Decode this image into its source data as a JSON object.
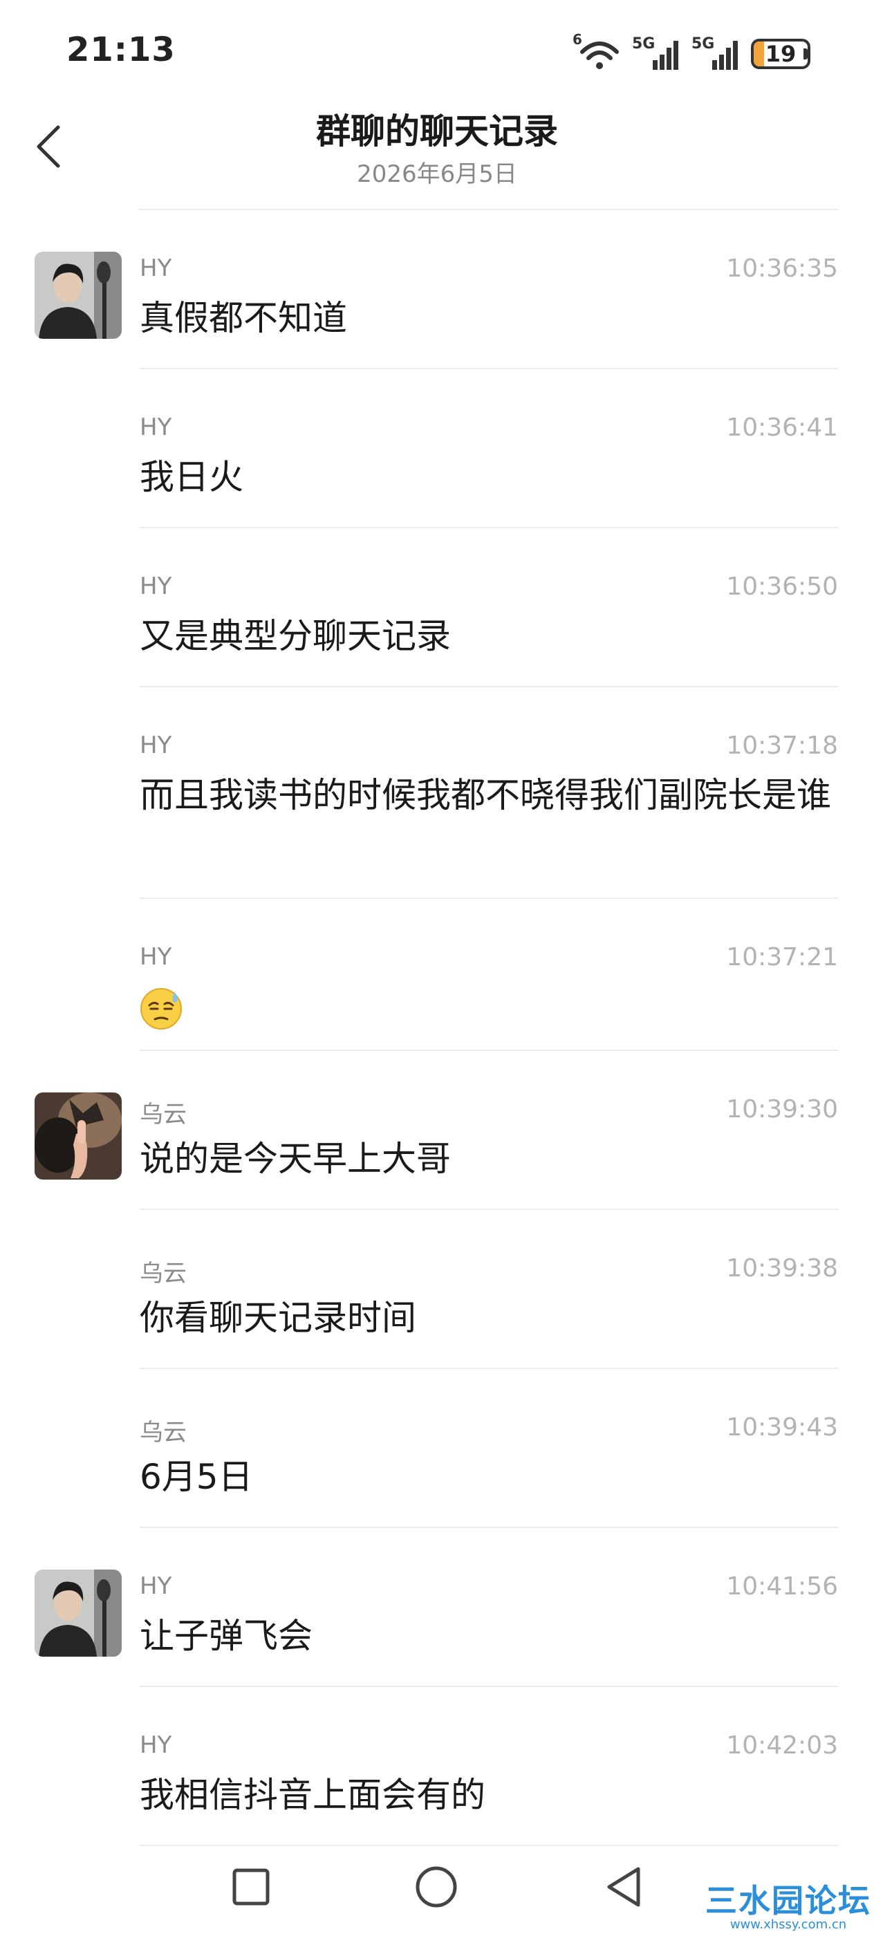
{
  "status_bar": {
    "time": "21:13",
    "battery": "19",
    "battery_level": 0.19,
    "icons": [
      "wifi-icon",
      "signal-5g-sim1-icon",
      "signal-5g-sim2-icon",
      "battery-icon"
    ],
    "wifi_badge": "6",
    "sim1_label": "5G",
    "sim2_label": "5G"
  },
  "header": {
    "title": "群聊的聊天记录",
    "subtitle": "2026年6月5日",
    "back_icon": "chevron-left-icon"
  },
  "messages": [
    {
      "sender": "HY",
      "time": "10:36:35",
      "text": "真假都不知道",
      "avatar": "hy"
    },
    {
      "sender": "HY",
      "time": "10:36:41",
      "text": "我日火"
    },
    {
      "sender": "HY",
      "time": "10:36:50",
      "text": "又是典型分聊天记录"
    },
    {
      "sender": "HY",
      "time": "10:37:18",
      "text": "而且我读书的时候我都不晓得我们副院长是谁"
    },
    {
      "sender": "HY",
      "time": "10:37:21",
      "text": "",
      "emoji": "sweat-face-emoji"
    },
    {
      "sender": "乌云",
      "time": "10:39:30",
      "text": "说的是今天早上大哥",
      "avatar": "wuyun"
    },
    {
      "sender": "乌云",
      "time": "10:39:38",
      "text": "你看聊天记录时间"
    },
    {
      "sender": "乌云",
      "time": "10:39:43",
      "text": "6月5日"
    },
    {
      "sender": "HY",
      "time": "10:41:56",
      "text": "让子弹飞会",
      "avatar": "hy"
    },
    {
      "sender": "HY",
      "time": "10:42:03",
      "text": "我相信抖音上面会有的"
    }
  ],
  "nav_bar": {
    "icons": [
      "recents-square-icon",
      "home-circle-icon",
      "back-triangle-icon"
    ]
  },
  "watermark": {
    "brand": "三水园论坛",
    "url": "www.xhssy.com.cn"
  },
  "colors": {
    "text": "#1a1a1a",
    "meta": "#8a8a8a",
    "time": "#b3b3b3",
    "divider": "#ececec",
    "battery": "#f2a33a",
    "watermark": "#2b8ed8"
  }
}
